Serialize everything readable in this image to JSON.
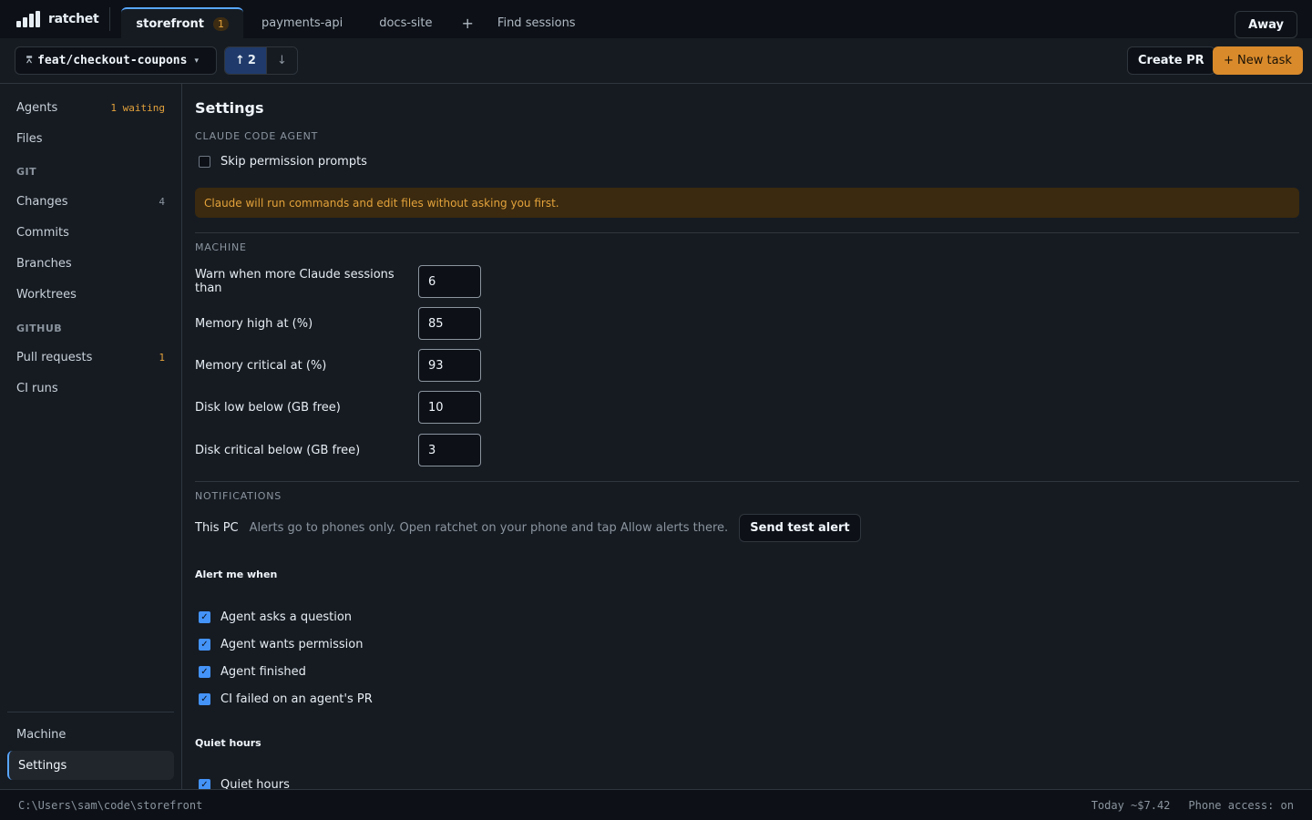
{
  "app": {
    "name": "ratchet"
  },
  "tabs": [
    {
      "label": "storefront",
      "badge": "1",
      "active": true
    },
    {
      "label": "payments-api"
    },
    {
      "label": "docs-site"
    }
  ],
  "tab_add_label": "+",
  "find_sessions_label": "Find sessions",
  "away_label": "Away",
  "branch": {
    "name": "feat/checkout-coupons",
    "ahead": "2",
    "ahead_icon": "↑",
    "behind_icon": "↓"
  },
  "toolbar": {
    "create_pr_label": "Create PR",
    "new_task_label": "+ New task"
  },
  "sidebar": {
    "agents": {
      "label": "Agents",
      "count": "1 waiting"
    },
    "files": {
      "label": "Files"
    },
    "git_heading": "GIT",
    "changes": {
      "label": "Changes",
      "count": "4"
    },
    "commits": {
      "label": "Commits"
    },
    "branches": {
      "label": "Branches"
    },
    "worktrees": {
      "label": "Worktrees"
    },
    "github_heading": "GITHUB",
    "pull_requests": {
      "label": "Pull requests",
      "count": "1"
    },
    "ci_runs": {
      "label": "CI runs"
    },
    "machine": {
      "label": "Machine"
    },
    "settings": {
      "label": "Settings"
    }
  },
  "settings": {
    "title": "Settings",
    "claude_heading": "CLAUDE CODE AGENT",
    "skip_prompts": {
      "label": "Skip permission prompts",
      "checked": false
    },
    "warning_text": "Claude will run commands and edit files without asking you first.",
    "machine_heading": "MACHINE",
    "fields": [
      {
        "label": "Warn when more Claude sessions than",
        "value": "6"
      },
      {
        "label": "Memory high at (%)",
        "value": "85"
      },
      {
        "label": "Memory critical at (%)",
        "value": "93"
      },
      {
        "label": "Disk low below (GB free)",
        "value": "10"
      },
      {
        "label": "Disk critical below (GB free)",
        "value": "3"
      }
    ],
    "notifications_heading": "NOTIFICATIONS",
    "this_pc_label": "This PC",
    "this_pc_desc": "Alerts go to phones only. Open ratchet on your phone and tap Allow alerts there.",
    "test_alert_label": "Send test alert",
    "alert_me_heading": "Alert me when",
    "alerts": [
      {
        "label": "Agent asks a question",
        "checked": true
      },
      {
        "label": "Agent wants permission",
        "checked": true
      },
      {
        "label": "Agent finished",
        "checked": true
      },
      {
        "label": "CI failed on an agent's PR",
        "checked": true
      }
    ],
    "quiet_heading": "Quiet hours",
    "quiet_toggle": {
      "label": "Quiet hours",
      "checked": true
    }
  },
  "statusbar": {
    "path": "C:\\Users\\sam\\code\\storefront",
    "cost": "Today ~$7.42",
    "phone_access": "Phone access: on"
  },
  "colors": {
    "accent": "#58a6ff",
    "warning": "#e3a23b",
    "primary_button": "#d98a2b",
    "checkbox": "#4493f8"
  }
}
